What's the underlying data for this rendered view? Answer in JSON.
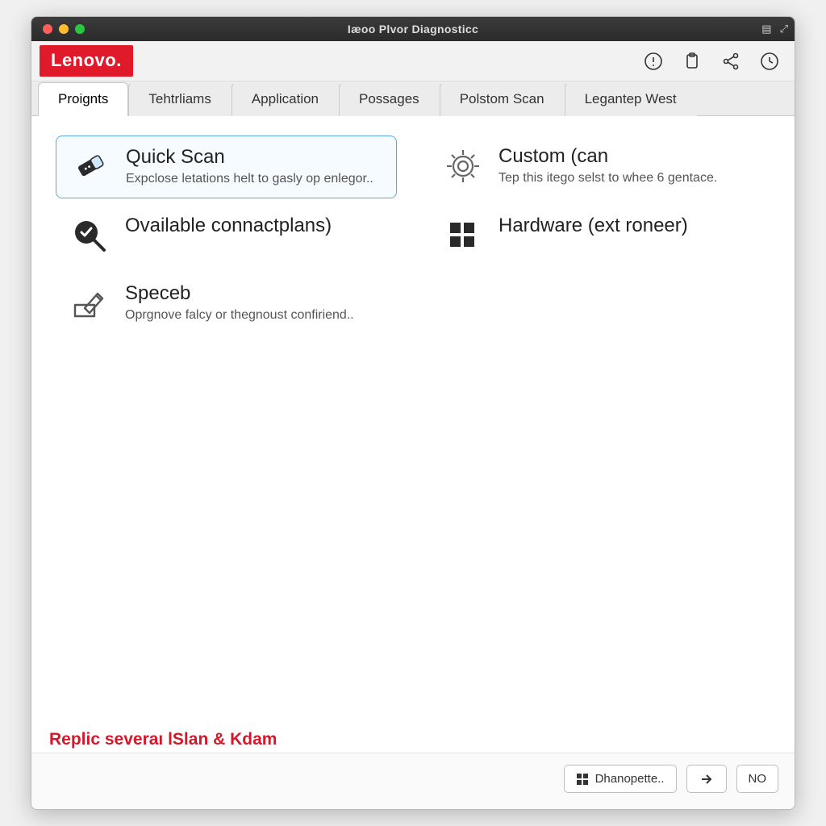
{
  "window": {
    "title": "Iæoo Plvor Diagnosticc"
  },
  "brand": {
    "logo_text": "Lenovo."
  },
  "header_icons": {
    "alert": "alert-icon",
    "clipboard": "clipboard-icon",
    "share": "share-icon",
    "clock": "clock-icon"
  },
  "tabs": [
    {
      "label": "Proignts",
      "active": true
    },
    {
      "label": "Tehtrliams"
    },
    {
      "label": "Application"
    },
    {
      "label": "Possages"
    },
    {
      "label": "Polstom Scan"
    },
    {
      "label": "Legantep West"
    }
  ],
  "cards": {
    "quick_scan": {
      "title": "Quick Scan",
      "desc": "Expclose letations helt to gasly op enlegor.."
    },
    "custom_scan": {
      "title": "Custom (can",
      "desc": "Tep this itego selst to whee 6 gentace."
    },
    "available": {
      "title": "Ovailable connactplans)",
      "desc": ""
    },
    "hardware": {
      "title": "Hardware (ext roneer)",
      "desc": ""
    },
    "speceb": {
      "title": "Speceb",
      "desc": "Oprgnove falcy or thegnoust confiriend.."
    }
  },
  "footer": {
    "note": "Replic severaı lSlan & Kdam",
    "btn_main": "Dhanopette..",
    "btn_no": "NO"
  }
}
